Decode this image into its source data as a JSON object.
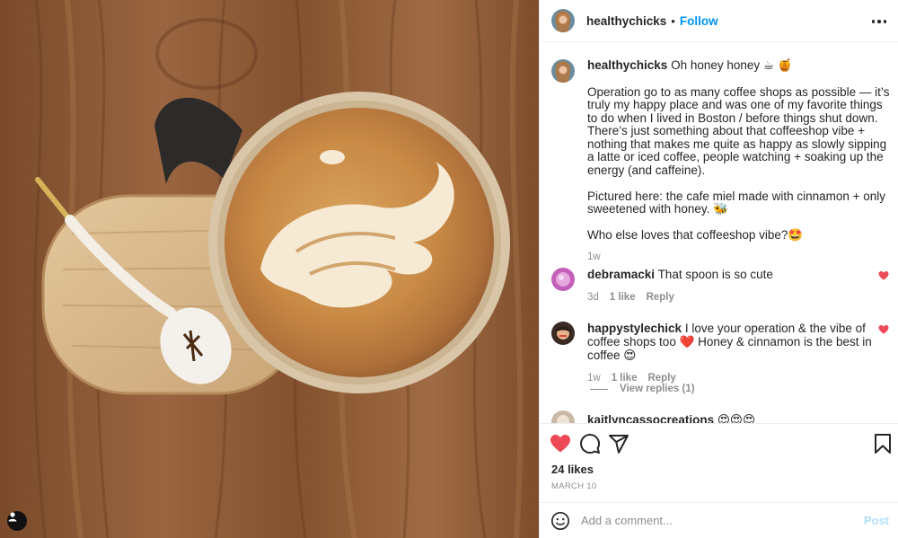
{
  "post": {
    "author": "healthychicks",
    "follow_label": "Follow",
    "separator": "•"
  },
  "caption": {
    "username": "healthychicks",
    "first_line": "Oh honey honey ☕ 🍯",
    "para1": "Operation go to as many coffee shops as possible — it’s truly my happy place and was one of my favorite things to do when I lived in Boston / before things shut down. There’s just something about that coffeeshop vibe + nothing that makes me quite as happy as slowly sipping a latte or iced coffee, people watching + soaking up the energy (and caffeine).",
    "para2": "Pictured here: the cafe miel made with cinnamon + only sweetened with honey. 🐝",
    "para3": "Who else loves that coffeeshop vibe?🤩",
    "time": "1w"
  },
  "comments": [
    {
      "username": "debramacki",
      "text": "That spoon is so cute",
      "time": "3d",
      "likes": "1 like",
      "reply": "Reply"
    },
    {
      "username": "happystylechick",
      "text": "I love your operation & the vibe of coffee shops too ❤️ Honey & cinnamon is the best in coffee 😍",
      "time": "1w",
      "likes": "1 like",
      "reply": "Reply"
    }
  ],
  "view_replies": "View replies (1)",
  "partial_comment": {
    "username": "kaitlyncassocreations",
    "text": "😍😍😍"
  },
  "actions": {
    "likes": "24 likes",
    "date": "MARCH 10"
  },
  "add_comment": {
    "placeholder": "Add a comment...",
    "post_label": "Post"
  },
  "colors": {
    "accent": "#0095f6",
    "like_red": "#ed4956",
    "muted": "#8e8e8e"
  },
  "icons": [
    "tag-user-icon",
    "more-icon",
    "heart-icon",
    "comment-icon",
    "share-icon",
    "bookmark-icon",
    "emoji-icon"
  ]
}
